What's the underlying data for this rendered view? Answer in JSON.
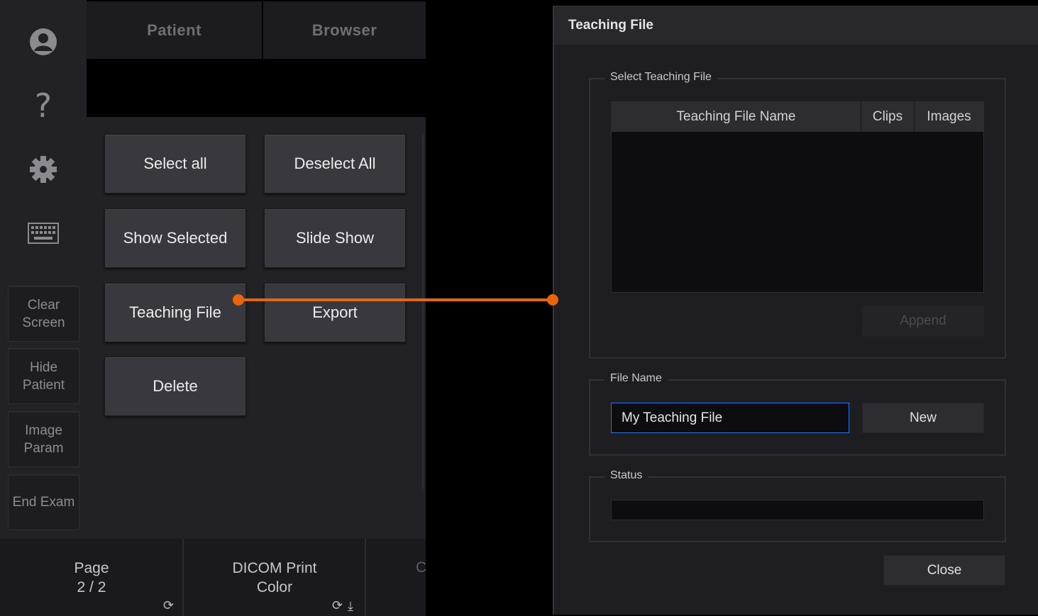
{
  "sidebar": {
    "buttons": [
      {
        "label": "Clear\nScreen"
      },
      {
        "label": "Hide\nPatient"
      },
      {
        "label": "Image\nParam"
      },
      {
        "label": "End Exam"
      }
    ],
    "icons": [
      "user-icon",
      "help-icon",
      "gear-icon",
      "keyboard-icon"
    ]
  },
  "tabs": [
    {
      "label": "Patient"
    },
    {
      "label": "Browser"
    }
  ],
  "actions": [
    {
      "label": "Select all"
    },
    {
      "label": "Deselect All"
    },
    {
      "label": "Show Selected"
    },
    {
      "label": "Slide Show"
    },
    {
      "label": "Teaching File"
    },
    {
      "label": "Export"
    },
    {
      "label": "Delete"
    }
  ],
  "bottom": {
    "page_label": "Page\n2 / 2",
    "print_label": "DICOM Print\nColor",
    "partial_label": "C"
  },
  "colors": {
    "connector": "#e8650d",
    "input_focus": "#2f6fd6"
  },
  "dialog": {
    "title": "Teaching File",
    "select_group_label": "Select Teaching File",
    "columns": [
      "Teaching File Name",
      "Clips",
      "Images"
    ],
    "append_label": "Append",
    "file_name_group_label": "File Name",
    "file_name_value": "My Teaching File",
    "new_label": "New",
    "status_group_label": "Status",
    "close_label": "Close"
  }
}
